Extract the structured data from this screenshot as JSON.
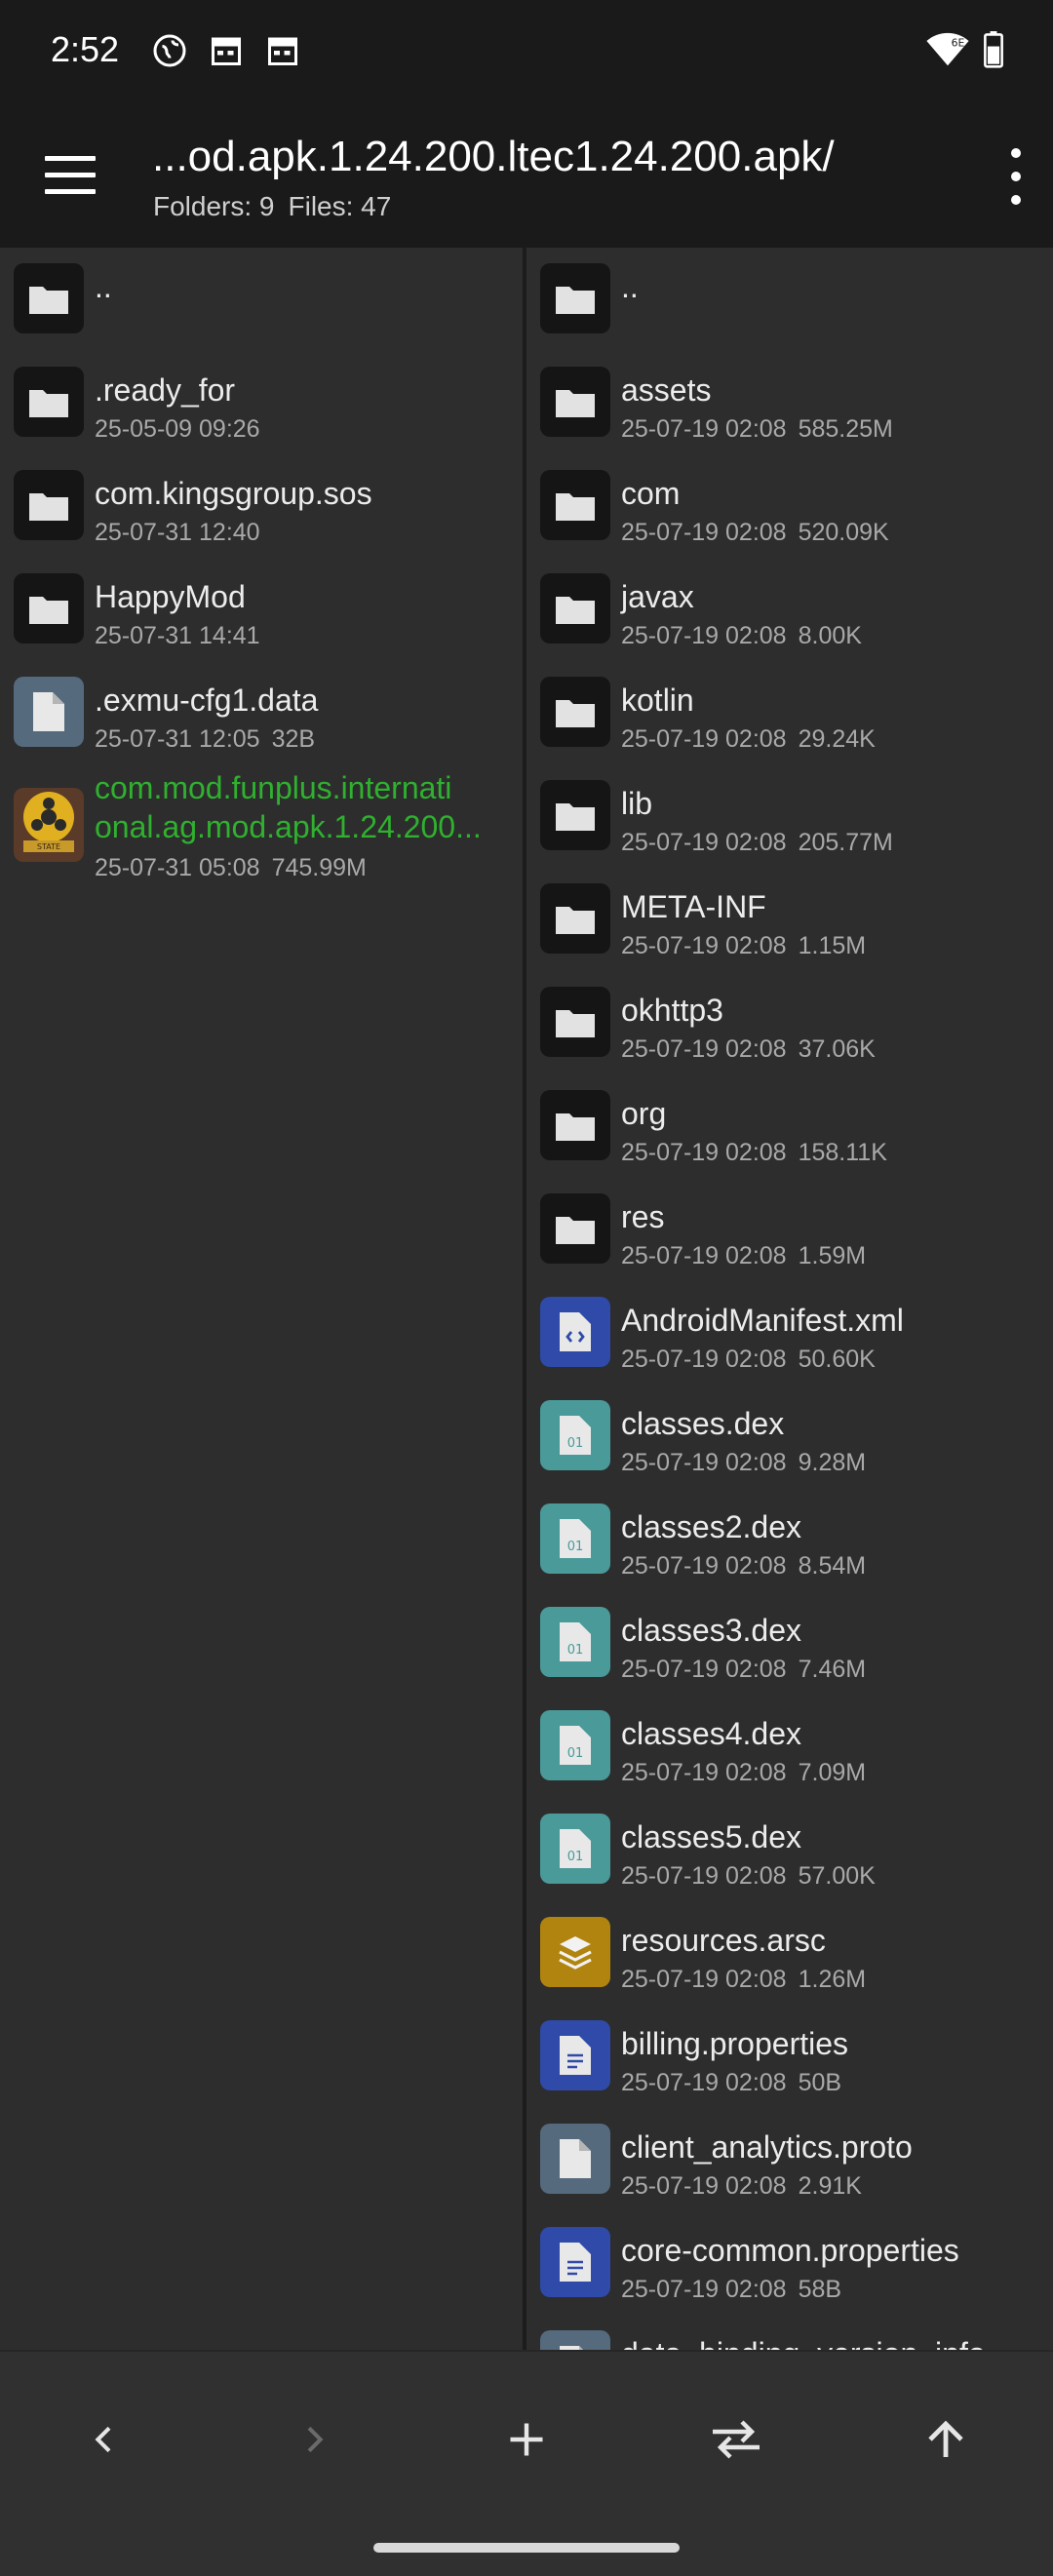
{
  "status_bar": {
    "time": "2:52",
    "network_badge": "6E"
  },
  "header": {
    "path": "...od.apk.1.24.200.ltec1.24.200.apk/",
    "folders_label": "Folders: 9",
    "files_label": "Files: 47"
  },
  "left_pane": {
    "parent": "..",
    "items": [
      {
        "name": ".ready_for",
        "date": "25-05-09 09:26",
        "size": "",
        "type": "folder"
      },
      {
        "name": "com.kingsgroup.sos",
        "date": "25-07-31 12:40",
        "size": "",
        "type": "folder"
      },
      {
        "name": "HappyMod",
        "date": "25-07-31 14:41",
        "size": "",
        "type": "folder"
      },
      {
        "name": ".exmu-cfg1.data",
        "date": "25-07-31 12:05",
        "size": "32B",
        "type": "file"
      }
    ],
    "apk": {
      "name_line1": "com.mod.funplus.internati",
      "name_line2": "onal.ag.mod.apk.1.24.200...",
      "date": "25-07-31 05:08",
      "size": "745.99M",
      "thumb_text": "STATE"
    }
  },
  "right_pane": {
    "parent": "..",
    "items": [
      {
        "name": "assets",
        "date": "25-07-19 02:08",
        "size": "585.25M",
        "type": "folder"
      },
      {
        "name": "com",
        "date": "25-07-19 02:08",
        "size": "520.09K",
        "type": "folder"
      },
      {
        "name": "javax",
        "date": "25-07-19 02:08",
        "size": "8.00K",
        "type": "folder"
      },
      {
        "name": "kotlin",
        "date": "25-07-19 02:08",
        "size": "29.24K",
        "type": "folder"
      },
      {
        "name": "lib",
        "date": "25-07-19 02:08",
        "size": "205.77M",
        "type": "folder"
      },
      {
        "name": "META-INF",
        "date": "25-07-19 02:08",
        "size": "1.15M",
        "type": "folder"
      },
      {
        "name": "okhttp3",
        "date": "25-07-19 02:08",
        "size": "37.06K",
        "type": "folder"
      },
      {
        "name": "org",
        "date": "25-07-19 02:08",
        "size": "158.11K",
        "type": "folder"
      },
      {
        "name": "res",
        "date": "25-07-19 02:08",
        "size": "1.59M",
        "type": "folder"
      },
      {
        "name": "AndroidManifest.xml",
        "date": "25-07-19 02:08",
        "size": "50.60K",
        "type": "xml"
      },
      {
        "name": "classes.dex",
        "date": "25-07-19 02:08",
        "size": "9.28M",
        "type": "dex"
      },
      {
        "name": "classes2.dex",
        "date": "25-07-19 02:08",
        "size": "8.54M",
        "type": "dex"
      },
      {
        "name": "classes3.dex",
        "date": "25-07-19 02:08",
        "size": "7.46M",
        "type": "dex"
      },
      {
        "name": "classes4.dex",
        "date": "25-07-19 02:08",
        "size": "7.09M",
        "type": "dex"
      },
      {
        "name": "classes5.dex",
        "date": "25-07-19 02:08",
        "size": "57.00K",
        "type": "dex"
      },
      {
        "name": "resources.arsc",
        "date": "25-07-19 02:08",
        "size": "1.26M",
        "type": "arsc"
      },
      {
        "name": "billing.properties",
        "date": "25-07-19 02:08",
        "size": "50B",
        "type": "text"
      },
      {
        "name": "client_analytics.proto",
        "date": "25-07-19 02:08",
        "size": "2.91K",
        "type": "file"
      },
      {
        "name": "core-common.properties",
        "date": "25-07-19 02:08",
        "size": "58B",
        "type": "text"
      },
      {
        "name": "data_binding_version_info",
        "date": "",
        "size": "",
        "type": "file"
      }
    ]
  },
  "dex_icon_text": "01",
  "colors": {
    "background": "#2b2b2b",
    "toolbar": "#1a1a1a",
    "apk_name": "#2fb12f",
    "xml_icon": "#2f4aa8",
    "dex_icon": "#4a9a9a",
    "arsc_icon": "#b0840e",
    "file_icon": "#556a7d"
  },
  "bottom_bar": [
    "back-icon",
    "forward-icon",
    "add-icon",
    "swap-icon",
    "up-icon"
  ]
}
